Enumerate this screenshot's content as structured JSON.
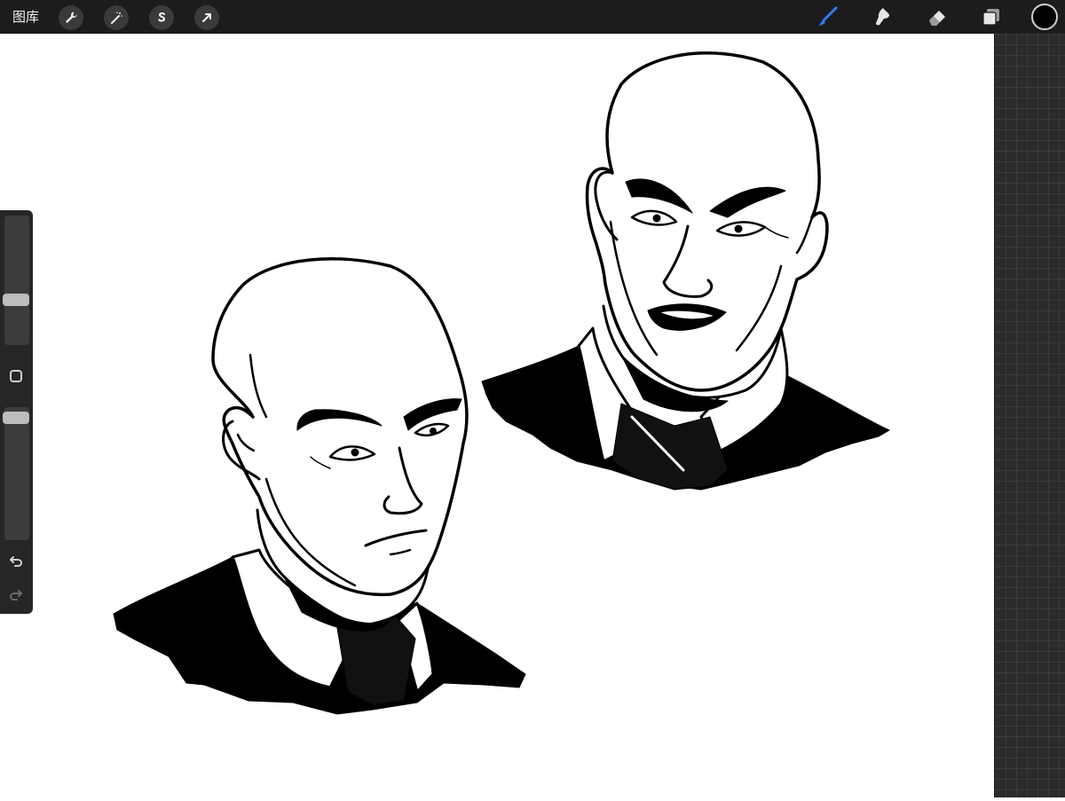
{
  "topbar": {
    "gallery_label": "图库",
    "left_tools": [
      {
        "name": "actions-wrench-icon"
      },
      {
        "name": "adjustments-magic-wand-icon"
      },
      {
        "name": "selection-s-icon"
      },
      {
        "name": "transform-arrow-icon"
      }
    ],
    "right_tools": [
      {
        "name": "brush-icon",
        "active": true
      },
      {
        "name": "smudge-icon"
      },
      {
        "name": "eraser-icon"
      },
      {
        "name": "layers-icon"
      }
    ],
    "active_color": "#000000",
    "accent_color": "#2f7cf6"
  },
  "sidebar": {
    "brush_size_level": 0.33,
    "opacity_level": 0.04
  },
  "canvas": {
    "background": "#ffffff",
    "artwork": [
      "bald-man-portrait-stern",
      "bald-man-portrait-shouting"
    ]
  }
}
